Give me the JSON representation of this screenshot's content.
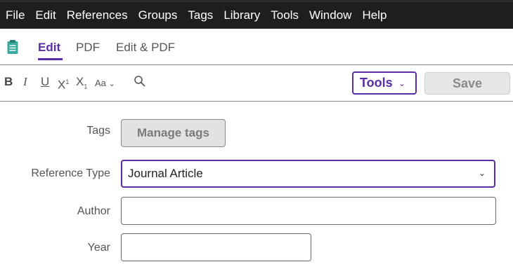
{
  "menubar": {
    "items": [
      "File",
      "Edit",
      "References",
      "Groups",
      "Tags",
      "Library",
      "Tools",
      "Window",
      "Help"
    ]
  },
  "tabs": {
    "edit": "Edit",
    "pdf": "PDF",
    "edit_pdf": "Edit & PDF",
    "active": "Edit"
  },
  "toolbar": {
    "bold": "B",
    "italic": "I",
    "underline": "U",
    "superscript_base": "X",
    "superscript_mark": "1",
    "subscript_base": "X",
    "subscript_mark": "1",
    "font_size": "Aa",
    "tools_label": "Tools",
    "save_label": "Save"
  },
  "form": {
    "tags_label": "Tags",
    "manage_tags_label": "Manage tags",
    "reference_type_label": "Reference Type",
    "reference_type_value": "Journal Article",
    "author_label": "Author",
    "author_value": "",
    "year_label": "Year",
    "year_value": ""
  },
  "colors": {
    "accent": "#5a2ca8",
    "menubar_bg": "#1e1e1e",
    "save_disabled_bg": "#e6e6e6"
  },
  "icons": [
    "notes-icon",
    "chevron-down-icon",
    "search-icon"
  ]
}
